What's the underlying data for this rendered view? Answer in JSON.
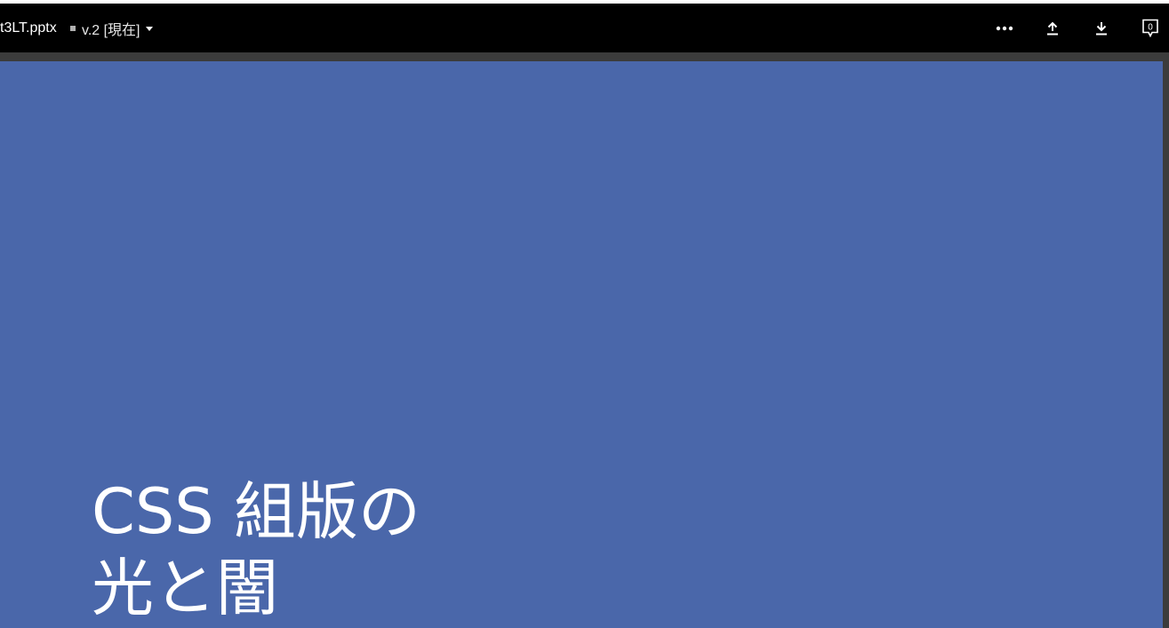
{
  "toolbar": {
    "filename": "t3LT.pptx",
    "version_label": "v.2 [現在]",
    "comment_count": "0",
    "icons": [
      "more-icon",
      "upload-icon",
      "download-icon",
      "comment-icon"
    ]
  },
  "slide": {
    "title_line1": "CSS 組版の",
    "title_line2": "光と闇",
    "background": "#4a67aa",
    "text_color": "#ffffff"
  },
  "colors": {
    "toolbar_bg": "#000000",
    "gutter_bg": "#3c3c3c"
  }
}
